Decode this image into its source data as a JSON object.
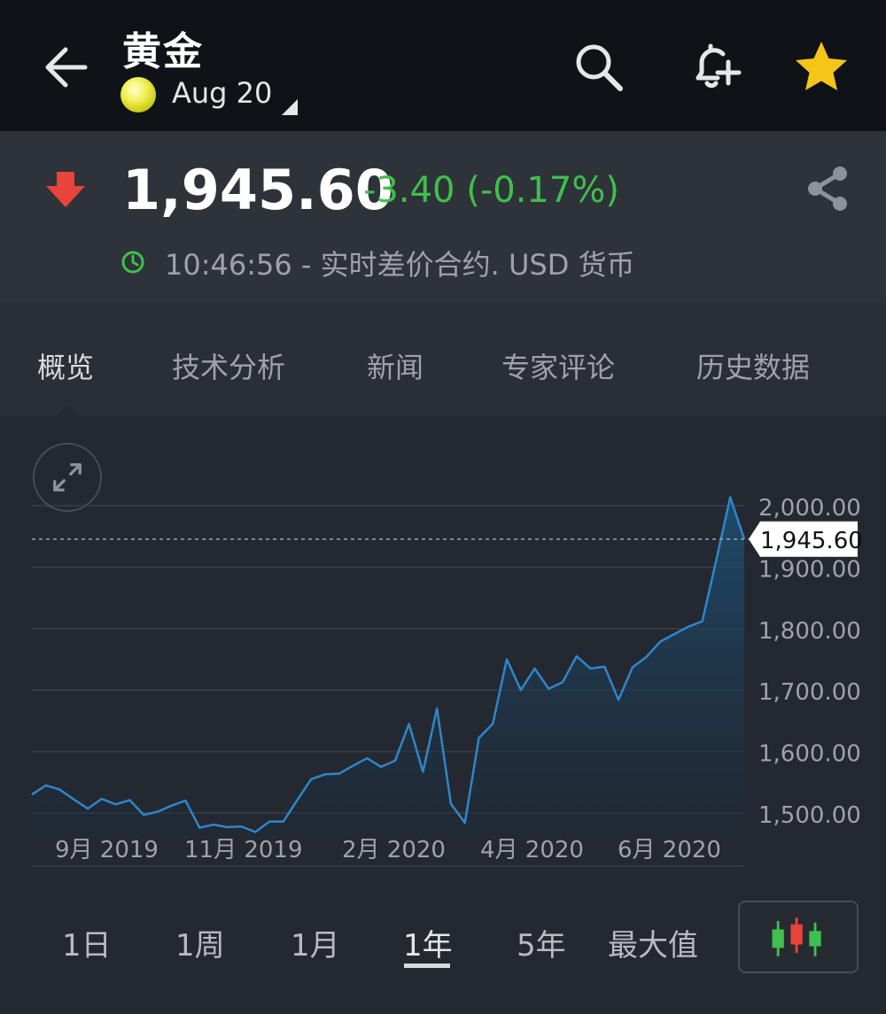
{
  "header": {
    "title": "黄金",
    "expiry": "Aug 20",
    "icons": [
      "back-arrow-icon",
      "search-icon",
      "add-alert-bell-icon",
      "star-icon"
    ],
    "star_color": "#f5c518"
  },
  "quote": {
    "price": "1,945.60",
    "change": "-3.40 (-0.17%)",
    "time_text": "10:46:56 - 实时差价合约. USD 货币",
    "colors": {
      "change": "#3fbf4d",
      "down_arrow": "#e8443a"
    }
  },
  "tabs": [
    {
      "label": "概览",
      "active": true
    },
    {
      "label": "技术分析",
      "active": false
    },
    {
      "label": "新闻",
      "active": false
    },
    {
      "label": "专家评论",
      "active": false
    },
    {
      "label": "历史数据",
      "active": false
    }
  ],
  "chart_data": {
    "type": "area",
    "current_value": 1945.6,
    "current_label": "1,945.60",
    "ylim": [
      1470,
      2040
    ],
    "y_ticks": [
      2000,
      1900,
      1800,
      1700,
      1600,
      1500
    ],
    "y_tick_labels": [
      "2,000.00",
      "1,900.00",
      "1,800.00",
      "1,700.00",
      "1,600.00",
      "1,500.00"
    ],
    "x_labels": [
      "9月 2019",
      "11月 2019",
      "2月 2020",
      "4月 2020",
      "6月 2020"
    ],
    "grid": true,
    "color": "#2f86c9",
    "values": [
      1530,
      1545,
      1538,
      1522,
      1507,
      1523,
      1514,
      1521,
      1497,
      1502,
      1512,
      1520,
      1476,
      1481,
      1477,
      1478,
      1469,
      1486,
      1486,
      1521,
      1555,
      1563,
      1564,
      1577,
      1589,
      1575,
      1585,
      1645,
      1567,
      1670,
      1515,
      1484,
      1622,
      1645,
      1750,
      1700,
      1735,
      1702,
      1713,
      1755,
      1735,
      1738,
      1684,
      1737,
      1754,
      1779,
      1791,
      1803,
      1812,
      1912,
      2014,
      1945.6
    ]
  },
  "range": {
    "buttons": [
      {
        "label": "1日",
        "active": false
      },
      {
        "label": "1周",
        "active": false
      },
      {
        "label": "1月",
        "active": false
      },
      {
        "label": "1年",
        "active": true
      },
      {
        "label": "5年",
        "active": false
      },
      {
        "label": "最大值",
        "active": false
      }
    ],
    "candles_icon": "candlestick-chart-icon"
  }
}
